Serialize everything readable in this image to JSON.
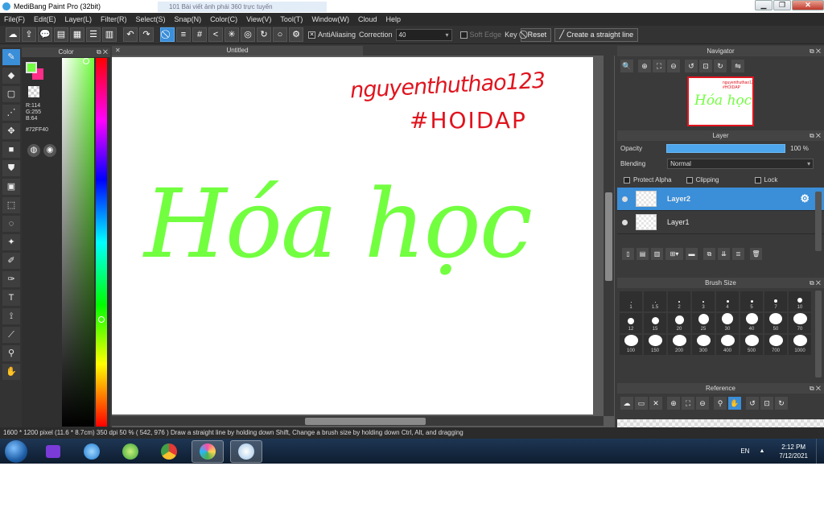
{
  "window": {
    "title": "MediBang Paint Pro (32bit)",
    "background_tab": "101 Bài viết ảnh phái 360 trực tuyến"
  },
  "menu": [
    "File(F)",
    "Edit(E)",
    "Layer(L)",
    "Filter(R)",
    "Select(S)",
    "Snap(N)",
    "Color(C)",
    "View(V)",
    "Tool(T)",
    "Window(W)",
    "Cloud",
    "Help"
  ],
  "toolbar": {
    "antialiasing_label": "AntiAliasing",
    "correction_label": "Correction",
    "correction_value": "40",
    "soft_edge_label": "Soft Edge",
    "key_label": "Key",
    "reset_label": "Reset",
    "straight_line_label": "Create a straight line"
  },
  "color_panel": {
    "title": "Color",
    "r": "R:114",
    "g": "G:255",
    "b": "B:64",
    "hex": "#72FF40",
    "foreground": "#72ff40",
    "background": "#ff2d88"
  },
  "canvas": {
    "tab_title": "Untitled",
    "signature_line1": "nguyenthuthao123",
    "signature_line2": "#HOIDAP",
    "main_text": "Hóa học",
    "ink_green": "#72ff40",
    "ink_red": "#e0141e"
  },
  "navigator": {
    "title": "Navigator",
    "thumb_text_small": "nguyenthuthao123 #HOIDAP",
    "thumb_text_main": "Hóa học"
  },
  "layer_panel": {
    "title": "Layer",
    "opacity_label": "Opacity",
    "opacity_value": "100 %",
    "blending_label": "Blending",
    "blending_value": "Normal",
    "protect_alpha_label": "Protect Alpha",
    "clipping_label": "Clipping",
    "lock_label": "Lock",
    "layers": [
      {
        "name": "Layer2",
        "active": true
      },
      {
        "name": "Layer1",
        "active": false
      }
    ]
  },
  "brush_size": {
    "title": "Brush Size",
    "sizes": [
      "1",
      "1.5",
      "2",
      "3",
      "4",
      "5",
      "7",
      "10",
      "12",
      "15",
      "20",
      "25",
      "30",
      "40",
      "50",
      "70",
      "100",
      "150",
      "200",
      "300",
      "400",
      "500",
      "700",
      "1000"
    ]
  },
  "reference": {
    "title": "Reference"
  },
  "status": {
    "text": "1600 * 1200 pixel   (11.6 * 8.7cm)   350 dpi   50 %   ( 542, 976 )   Draw a straight line by holding down Shift, Change a brush size by holding down Ctrl, Alt, and dragging"
  },
  "taskbar": {
    "lang": "EN",
    "time": "2:12 PM",
    "date": "7/12/2021",
    "accent": "#3b8ed8"
  }
}
